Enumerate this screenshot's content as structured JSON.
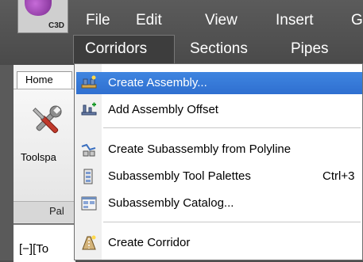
{
  "app": {
    "logo_text": "C3D"
  },
  "menubar": {
    "row1": [
      "File",
      "Edit",
      "View",
      "Insert",
      "G"
    ],
    "row2": [
      "Corridors",
      "Sections",
      "Pipes"
    ]
  },
  "ribbon": {
    "tab_home": "Home",
    "tool_label": "Toolspa",
    "panel_label": "Pal",
    "viewport_label": "[−][To"
  },
  "dropdown": {
    "items": [
      {
        "label": "Create Assembly...",
        "icon": "create-assembly-icon",
        "highlighted": true,
        "shortcut": ""
      },
      {
        "label": "Add Assembly Offset",
        "icon": "add-assembly-offset-icon",
        "highlighted": false,
        "shortcut": ""
      },
      {
        "label": "Create Subassembly from Polyline",
        "icon": "subassembly-polyline-icon",
        "highlighted": false,
        "shortcut": ""
      },
      {
        "label": "Subassembly Tool Palettes",
        "icon": "tool-palettes-icon",
        "highlighted": false,
        "shortcut": "Ctrl+3"
      },
      {
        "label": "Subassembly Catalog...",
        "icon": "catalog-icon",
        "highlighted": false,
        "shortcut": ""
      },
      {
        "label": "Create Corridor",
        "icon": "create-corridor-icon",
        "highlighted": false,
        "shortcut": ""
      }
    ]
  },
  "colors": {
    "highlight": "#3a7fdc",
    "menubar": "#4e4e4e",
    "menu_text": "#ffffff"
  }
}
